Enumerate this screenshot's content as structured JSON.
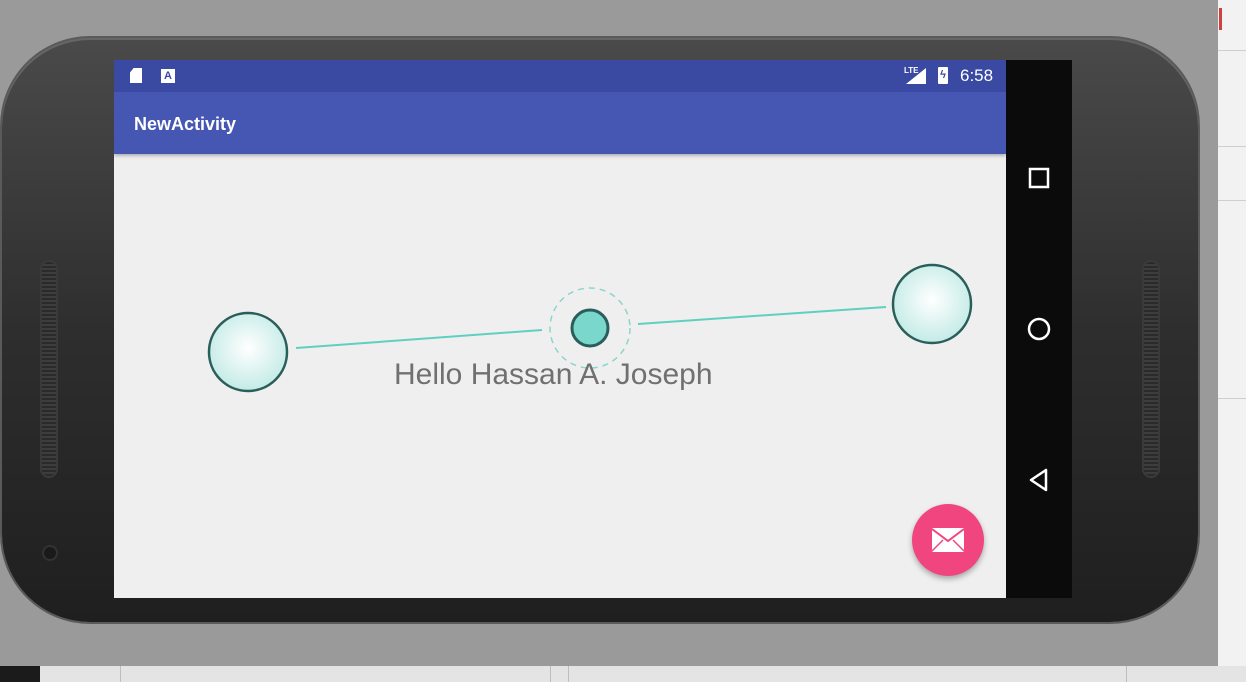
{
  "status_bar": {
    "network": "LTE",
    "time": "6:58",
    "icons": [
      "sd-card-icon",
      "font-a-icon",
      "signal-icon",
      "battery-charging-icon"
    ]
  },
  "app_bar": {
    "title": "NewActivity"
  },
  "content": {
    "greeting": "Hello Hassan A. Joseph"
  },
  "fab": {
    "icon": "email-icon",
    "color": "#f0457f"
  },
  "nav_bar": {
    "buttons": [
      "recents-icon",
      "home-icon",
      "back-icon"
    ]
  },
  "colors": {
    "status_bar": "#3a4aa3",
    "app_bar": "#4556b3",
    "accent_teal": "#7ad7cc",
    "node_stroke": "#2a5e5a"
  }
}
